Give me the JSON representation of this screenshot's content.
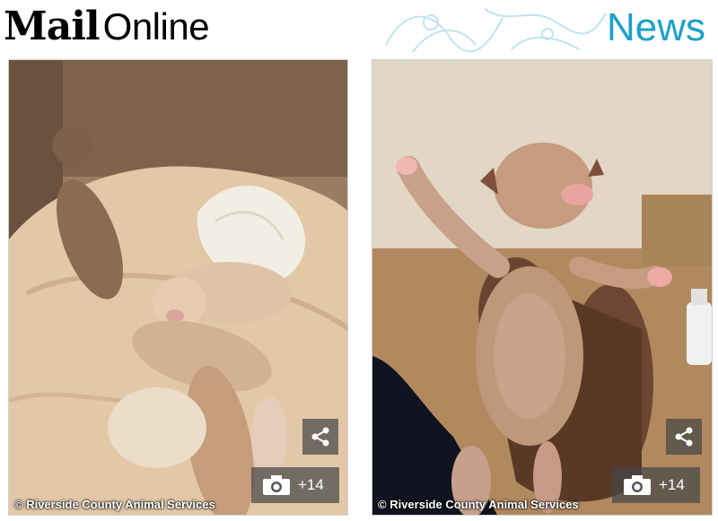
{
  "header": {
    "logo_part1": "Mail",
    "logo_part2": "Online",
    "section": "News"
  },
  "colors": {
    "section_accent": "#1ea0c8",
    "overlay_button": "#464646"
  },
  "photos": [
    {
      "share_icon": "share-icon",
      "gallery_icon": "camera-icon",
      "gallery_count": "+14",
      "credit": "© Riverside County Animal Services"
    },
    {
      "share_icon": "share-icon",
      "gallery_icon": "camera-icon",
      "gallery_count": "+14",
      "credit": "© Riverside County Animal Services"
    }
  ]
}
